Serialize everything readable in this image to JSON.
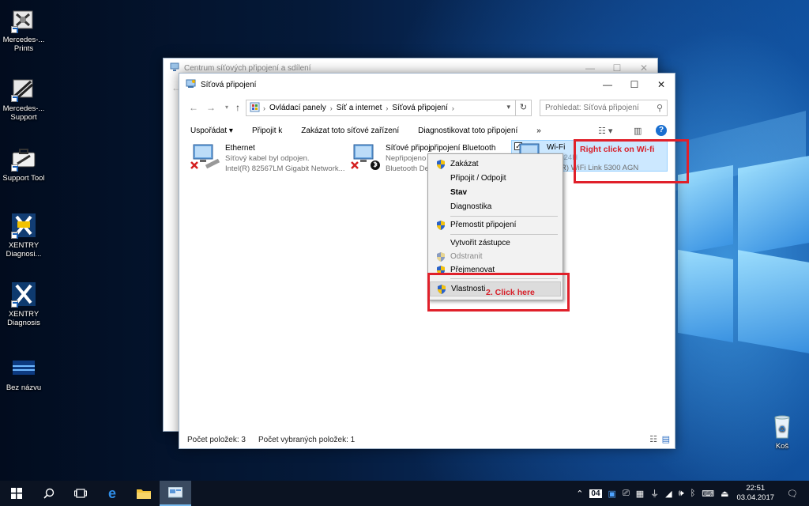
{
  "desktop": {
    "icons": [
      {
        "label": "Mercedes-...\nPrints",
        "icon": "mercedes-prints-icon"
      },
      {
        "label": "Mercedes-...\nSupport",
        "icon": "mercedes-support-icon"
      },
      {
        "label": "Support Tool",
        "icon": "toolbox-icon"
      },
      {
        "label": "XENTRY\nDiagnosi...",
        "icon": "xentry-sim-icon"
      },
      {
        "label": "XENTRY\nDiagnosis",
        "icon": "xentry-icon"
      },
      {
        "label": "Bez názvu",
        "icon": "image-file-icon"
      },
      {
        "label": "Koš",
        "icon": "recycle-bin-icon"
      }
    ]
  },
  "back_window": {
    "title": "Centrum síťových připojení a sdílení"
  },
  "window": {
    "title": "Síťová připojení",
    "breadcrumb": [
      "Ovládací panely",
      "Síť a internet",
      "Síťová připojení"
    ],
    "search_placeholder": "Prohledat: Síťová připojení",
    "commands": [
      "Uspořádat ▾",
      "Připojit k",
      "Zakázat toto síťové zařízení",
      "Diagnostikovat toto připojení",
      "»"
    ],
    "items": [
      {
        "name": "Ethernet",
        "status": "Síťový kabel byl odpojen.",
        "device": "Intel(R) 82567LM Gigabit Network..."
      },
      {
        "name": "Síťové připojení Bluetooth",
        "status": "Nepřipojeno",
        "device": "Bluetooth De"
      },
      {
        "name": "Wi-Fi",
        "status": "Pmal24H",
        "device": "R) WiFi Link 5300 AGN"
      }
    ],
    "status_count": "Počet položek: 3",
    "status_selected": "Počet vybraných položek: 1"
  },
  "context_menu": {
    "items": [
      {
        "label": "Zakázat",
        "shield": true,
        "style": "normal"
      },
      {
        "label": "Připojit / Odpojit",
        "shield": false,
        "style": "normal"
      },
      {
        "label": "Stav",
        "shield": false,
        "style": "bold"
      },
      {
        "label": "Diagnostika",
        "shield": false,
        "style": "normal"
      },
      {
        "label": "Přemostit připojení",
        "shield": true,
        "style": "normal"
      },
      {
        "label": "Vytvořit zástupce",
        "shield": false,
        "style": "normal"
      },
      {
        "label": "Odstranit",
        "shield": true,
        "style": "disabled"
      },
      {
        "label": "Přejmenovat",
        "shield": true,
        "style": "normal"
      },
      {
        "label": "Vlastnosti",
        "shield": true,
        "style": "highlighted"
      }
    ]
  },
  "annotations": {
    "right_click": "Right click on Wi-fi",
    "click_here": "2. Click here"
  },
  "taskbar": {
    "time": "22:51",
    "date": "03.04.2017",
    "language_badge": "04"
  },
  "colors": {
    "annotation_red": "#e0202a",
    "selection_blue": "#cce8ff",
    "help_blue": "#1a6fd0",
    "taskbar": "#0b1322"
  }
}
